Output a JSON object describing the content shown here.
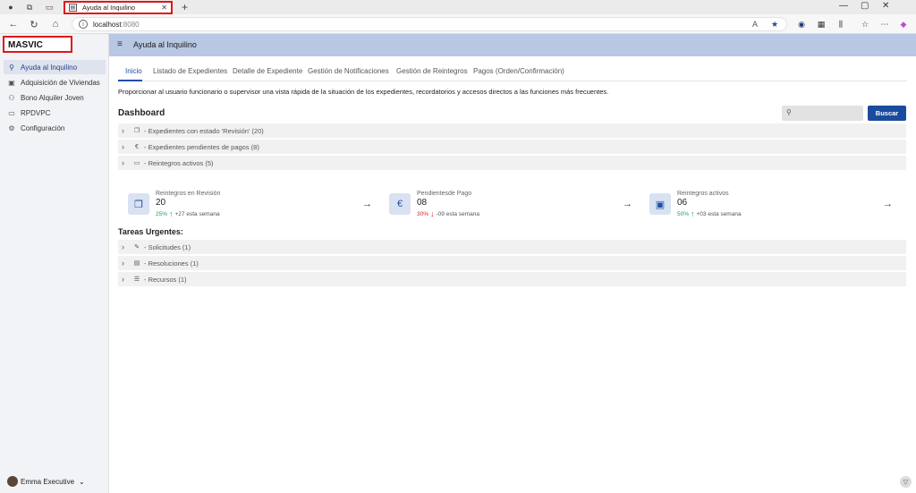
{
  "browser": {
    "tab_title": "Ayuda al Inquilino",
    "url_host": "localhost",
    "url_port": ":8080"
  },
  "app": {
    "brand": "MASVIC",
    "header_title": "Ayuda al Inquilino"
  },
  "sidebar": {
    "items": [
      {
        "label": "Ayuda al Inquilino",
        "icon": "person-icon",
        "active": true
      },
      {
        "label": "Adquisición de Viviendas",
        "icon": "house-icon",
        "active": false
      },
      {
        "label": "Bono Alquiler Joven",
        "icon": "people-icon",
        "active": false
      },
      {
        "label": "RPDVPC",
        "icon": "card-icon",
        "active": false
      },
      {
        "label": "Configuración",
        "icon": "gear-icon",
        "active": false
      }
    ],
    "user_name": "Emma Executive"
  },
  "tabs": [
    {
      "label": "Inicio",
      "active": true
    },
    {
      "label": "Listado de Expedientes",
      "active": false
    },
    {
      "label": "Detalle de Expediente",
      "active": false
    },
    {
      "label": "Gestión de Notificaciones",
      "active": false
    },
    {
      "label": "Gestión de Reintegros",
      "active": false
    },
    {
      "label": "Pagos (Orden/Confirmación)",
      "active": false
    }
  ],
  "main": {
    "description": "Proporcionar al usuario funcionario o supervisor una vista rápida de la situación de los expedientes, recordatorios y accesos directos a las funciones más frecuentes.",
    "dashboard_title": "Dashboard",
    "search_placeholder": "",
    "search_button": "Buscar",
    "dashboard_items": [
      {
        "label": "- Expedientes con estado 'Revisión' (20)",
        "icon": "copy-icon"
      },
      {
        "label": "- Expedientes pendientes de pagos (8)",
        "icon": "euro-icon"
      },
      {
        "label": "- Reintegros activos (5)",
        "icon": "money-icon"
      }
    ],
    "cards": [
      {
        "label": "Reintegros en Revisión",
        "value": "20",
        "percent": "25%",
        "direction": "up",
        "week": "+27 esta semana",
        "icon": "copy-icon"
      },
      {
        "label": "Pendientesde Pago",
        "value": "08",
        "percent": "30%",
        "direction": "down",
        "week": "-09 esta semana",
        "icon": "euro-icon"
      },
      {
        "label": "Reintegros activos",
        "value": "06",
        "percent": "50%",
        "direction": "up",
        "week": "+03 esta semana",
        "icon": "money-icon"
      }
    ],
    "urgent_title": "Tareas Urgentes:",
    "urgent_items": [
      {
        "label": "- Solicitudes (1)",
        "icon": "edit-icon"
      },
      {
        "label": "- Resoluciones (1)",
        "icon": "document-icon"
      },
      {
        "label": "- Recursos (1)",
        "icon": "list-icon"
      }
    ]
  },
  "colors": {
    "primary": "#1b4b9c",
    "header_bg": "#b8c7e3",
    "trend_up": "#1e9f5a",
    "trend_down": "#d62828",
    "highlight_border": "#e0161b"
  }
}
